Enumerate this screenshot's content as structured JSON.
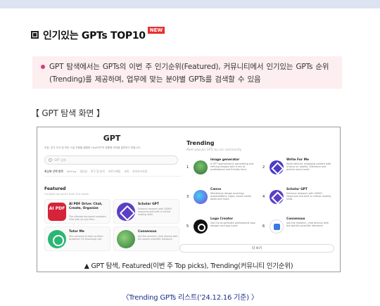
{
  "heading": {
    "text": "인기있는 GPTs TOP10",
    "badge": "NEW"
  },
  "callout": {
    "text": "GPT 탐색에서는 GPTs의 이번 주 인기순위(Featured), 커뮤니티에서 인기있는 GPTs 순위(Trending)를 제공하며, 업무에 맞는 분야별 GPTs를 검색할 수 있음"
  },
  "section_label": "【 GPT 탐색 화면 】",
  "screenshot": {
    "title": "GPT",
    "description": "지침, 추가 지식 및 모든 스킬 조합을 결합한 ChatGPT의 맞춤형 버전을 발견하고 만듭니다.",
    "search_placeholder": "GPT 검색",
    "categories": [
      "최상위 선택 항목",
      "Writing",
      "생산성",
      "연구 및 분석",
      "프로그래밍",
      "교육",
      "라이프스타일"
    ],
    "featured": {
      "title": "Featured",
      "subtitle": "Curated top picks from this week",
      "cards": [
        {
          "icon": "ai-pdf-icon",
          "icon_text": "AI PDF",
          "name": "AI PDF Drive: Chat, Create, Organize",
          "desc": "The ultimate document assistant. Chat with all your files..."
        },
        {
          "icon": "scholar-gpt-icon",
          "name": "Scholar GPT",
          "desc": "Enhance research with 200M+ resources and built-in critical reading skills."
        },
        {
          "icon": "tutor-me-icon",
          "name": "Tutor Me",
          "desc": "Your personal AI tutor by Khan Academy! I'm Khanmigo Lite."
        },
        {
          "icon": "consensus-icon",
          "name": "Consensus",
          "desc": "Ask the research, chat directly with the world's scientific literature."
        }
      ]
    },
    "trending": {
      "title": "Trending",
      "subtitle": "Most popular GPTs by our community",
      "items": [
        {
          "rank": "1",
          "icon": "image-generator-icon",
          "name": "image generator",
          "desc": "A GPT specialized in generating and refining images with a mix of professional and friendly tone."
        },
        {
          "rank": "2",
          "icon": "write-for-me-icon",
          "name": "Write For Me",
          "desc": "Write tailored, engaging content with a focus on quality, relevance and precise word count."
        },
        {
          "rank": "3",
          "icon": "canva-icon",
          "name": "Canva",
          "desc": "Effortlessly design anything: presentations, logos, social media posts and more."
        },
        {
          "rank": "4",
          "icon": "scholar-gpt-icon",
          "name": "Scholar GPT",
          "desc": "Enhance research with 200M+ resources and built-in critical reading skills."
        },
        {
          "rank": "5",
          "icon": "logo-creator-icon",
          "name": "Logo Creator",
          "desc": "Use me to generate professional logo designs and app icons!"
        },
        {
          "rank": "6",
          "icon": "consensus-icon",
          "name": "Consensus",
          "desc": "Ask the research, chat directly with the world's scientific literature."
        }
      ],
      "more_label": "더 보기"
    }
  },
  "caption": "▲ GPT 탐색, Featured(이번 주 Top picks), Trending(커뮤니티 인기순위)",
  "bottom_title": "〈Trending GPTs 리스트('24.12.16 기준) 〉"
}
